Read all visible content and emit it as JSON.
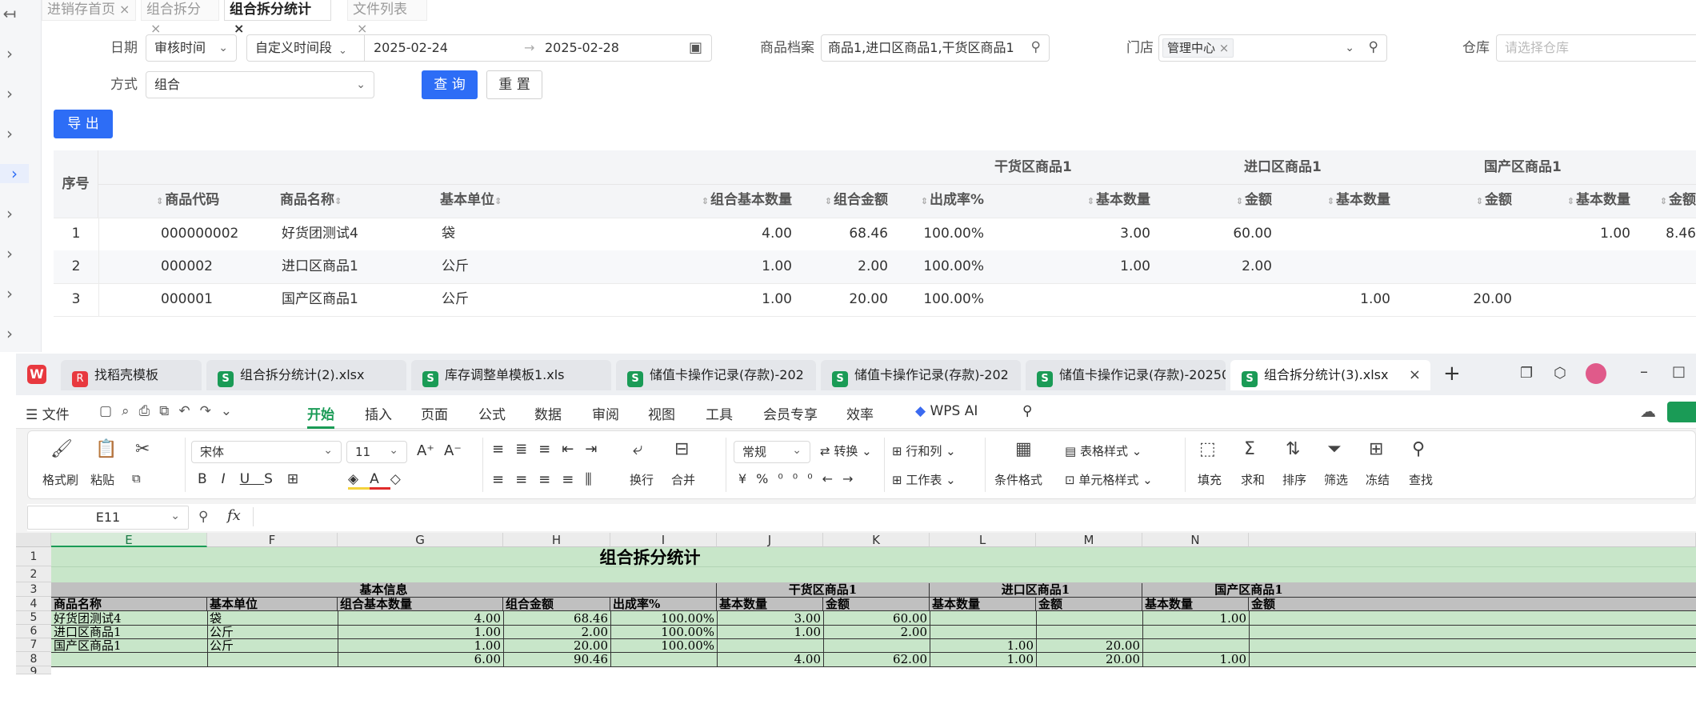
{
  "page_tabs": [
    {
      "label": "进销存首页",
      "active": false
    },
    {
      "label": "组合拆分",
      "active": false
    },
    {
      "label": "组合拆分统计",
      "active": true
    },
    {
      "label": "文件列表",
      "active": false
    }
  ],
  "filters": {
    "date_label": "日期",
    "date_type": "审核时间",
    "date_range_type": "自定义时间段",
    "date_start": "2025-02-24",
    "date_sep": "→",
    "date_end": "2025-02-28",
    "product_label": "商品档案",
    "product_value": "商品1,进口区商品1,干货区商品1",
    "store_label": "门店",
    "store_tag": "管理中心",
    "warehouse_label": "仓库",
    "warehouse_placeholder": "请选择仓库",
    "mode_label": "方式",
    "mode_value": "组合",
    "query_btn": "查 询",
    "reset_btn": "重 置",
    "export_btn": "导 出"
  },
  "grid": {
    "seq_header": "序号",
    "group_headers": [
      "干货区商品1",
      "进口区商品1",
      "国产区商品1"
    ],
    "columns": [
      "商品代码",
      "商品名称",
      "基本单位",
      "组合基本数量",
      "组合金额",
      "出成率%",
      "基本数量",
      "金额",
      "基本数量",
      "金额",
      "基本数量",
      "金额"
    ],
    "rows": [
      {
        "seq": "1",
        "code": "000000002",
        "name": "好货团测试4",
        "unit": "袋",
        "qty": "4.00",
        "amt": "68.46",
        "rate": "100.00%",
        "g1q": "3.00",
        "g1a": "60.00",
        "g2q": "",
        "g2a": "",
        "g3q": "1.00",
        "g3a": "8.46"
      },
      {
        "seq": "2",
        "code": "000002",
        "name": "进口区商品1",
        "unit": "公斤",
        "qty": "1.00",
        "amt": "2.00",
        "rate": "100.00%",
        "g1q": "1.00",
        "g1a": "2.00",
        "g2q": "",
        "g2a": "",
        "g3q": "",
        "g3a": ""
      },
      {
        "seq": "3",
        "code": "000001",
        "name": "国产区商品1",
        "unit": "公斤",
        "qty": "1.00",
        "amt": "20.00",
        "rate": "100.00%",
        "g1q": "",
        "g1a": "",
        "g2q": "1.00",
        "g2a": "20.00",
        "g3q": "",
        "g3a": ""
      }
    ]
  },
  "wps": {
    "tabs": [
      {
        "label": "找稻壳模板",
        "icon": "R"
      },
      {
        "label": "组合拆分统计(2).xlsx",
        "icon": "S"
      },
      {
        "label": "库存调整单模板1.xls",
        "icon": "S"
      },
      {
        "label": "储值卡操作记录(存款)-202",
        "icon": "S"
      },
      {
        "label": "储值卡操作记录(存款)-202",
        "icon": "S"
      },
      {
        "label": "储值卡操作记录(存款)-20250",
        "icon": "S"
      },
      {
        "label": "组合拆分统计(3).xlsx",
        "icon": "S"
      }
    ],
    "file_menu": "文件",
    "menus": [
      "开始",
      "插入",
      "页面",
      "公式",
      "数据",
      "审阅",
      "视图",
      "工具",
      "会员专享",
      "效率"
    ],
    "wps_ai": "WPS AI",
    "ribbon": {
      "format_painter": "格式刷",
      "paste": "粘贴",
      "font_name": "宋体",
      "font_size": "11",
      "number_format": "常规",
      "convert": "转换",
      "row_col": "行和列",
      "worksheet": "工作表",
      "wrap": "换行",
      "merge": "合并",
      "cond_format": "条件格式",
      "table_style": "表格样式",
      "cell_style": "单元格样式",
      "fill": "填充",
      "sum": "求和",
      "sort": "排序",
      "filter": "筛选",
      "freeze": "冻结",
      "find": "查找"
    },
    "cell_ref": "E11",
    "fx": "fx",
    "col_letters": [
      "E",
      "F",
      "G",
      "H",
      "I",
      "J",
      "K",
      "L",
      "M",
      "N"
    ],
    "row_numbers": [
      "1",
      "2",
      "3",
      "4",
      "5",
      "6",
      "7",
      "8",
      "9"
    ],
    "sheet_title": "组合拆分统计",
    "basic_info": "基本信息",
    "group_headers": [
      "干货区商品1",
      "进口区商品1",
      "国产区商品1"
    ],
    "headers": [
      "商品名称",
      "基本单位",
      "组合基本数量",
      "组合金额",
      "出成率%",
      "基本数量",
      "金额",
      "基本数量",
      "金额",
      "基本数量",
      "金额"
    ],
    "rows": [
      [
        "好货团测试4",
        "袋",
        "4.00",
        "68.46",
        "100.00%",
        "3.00",
        "60.00",
        "",
        "",
        "1.00",
        ""
      ],
      [
        "进口区商品1",
        "公斤",
        "1.00",
        "2.00",
        "100.00%",
        "1.00",
        "2.00",
        "",
        "",
        "",
        ""
      ],
      [
        "国产区商品1",
        "公斤",
        "1.00",
        "20.00",
        "100.00%",
        "",
        "",
        "1.00",
        "20.00",
        "",
        ""
      ],
      [
        "",
        "",
        "6.00",
        "90.46",
        "",
        "4.00",
        "62.00",
        "1.00",
        "20.00",
        "1.00",
        ""
      ]
    ]
  }
}
